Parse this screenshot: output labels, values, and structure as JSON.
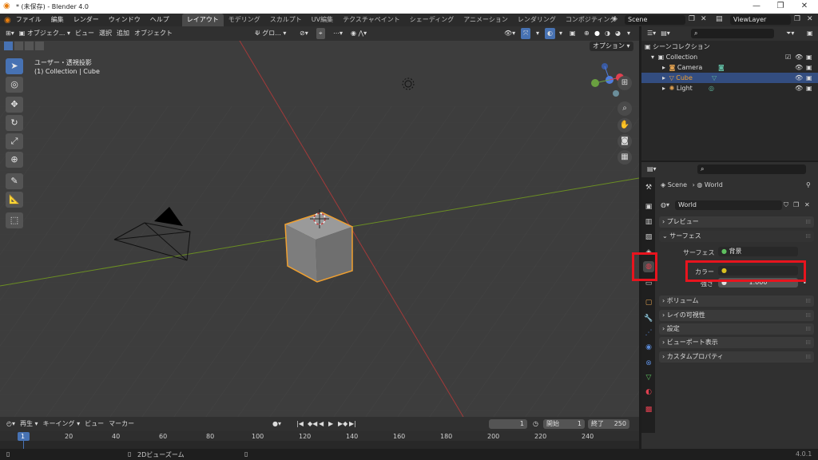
{
  "window": {
    "title": "* (未保存) - Blender 4.0"
  },
  "menu": {
    "items": [
      "ファイル",
      "編集",
      "レンダー",
      "ウィンドウ",
      "ヘルプ"
    ],
    "workspaces": [
      "レイアウト",
      "モデリング",
      "スカルプト",
      "UV編集",
      "テクスチャペイント",
      "シェーディング",
      "アニメーション",
      "レンダリング",
      "コンポジティング"
    ],
    "scene": "Scene",
    "viewlayer": "ViewLayer"
  },
  "viewport": {
    "mode": "オブジェク...",
    "menus": [
      "ビュー",
      "選択",
      "追加",
      "オブジェクト"
    ],
    "transform": "グロ...",
    "options": "オプション",
    "info_line1": "ユーザー・透視投影",
    "info_line2": "(1) Collection | Cube"
  },
  "outliner": {
    "root": "シーンコレクション",
    "collection": "Collection",
    "items": [
      "Camera",
      "Cube",
      "Light"
    ]
  },
  "properties": {
    "breadcrumb_scene": "Scene",
    "breadcrumb_world": "World",
    "world_name": "World",
    "panels": {
      "preview": "プレビュー",
      "surface": "サーフェス",
      "surface_label": "サーフェス",
      "surface_value": "背景",
      "color_label": "カラー",
      "strength_label": "強さ",
      "strength_value": "1.000",
      "volume": "ボリューム",
      "ray_visibility": "レイの可視性",
      "settings": "設定",
      "viewport_display": "ビューポート表示",
      "custom_props": "カスタムプロパティ"
    }
  },
  "timeline": {
    "menus": [
      "再生",
      "キーイング",
      "ビュー",
      "マーカー"
    ],
    "current_frame": "1",
    "start_label": "開始",
    "start": "1",
    "end_label": "終了",
    "end": "250",
    "ticks": [
      "1",
      "20",
      "40",
      "60",
      "80",
      "100",
      "120",
      "140",
      "160",
      "180",
      "200",
      "220",
      "240"
    ]
  },
  "status": {
    "hint": "2Dビューズーム",
    "version": "4.0.1"
  },
  "colors": {
    "accent": "#4772b3",
    "selection": "#334d80",
    "highlight_box": "#e8141e",
    "cube_outline": "#f0a030"
  }
}
